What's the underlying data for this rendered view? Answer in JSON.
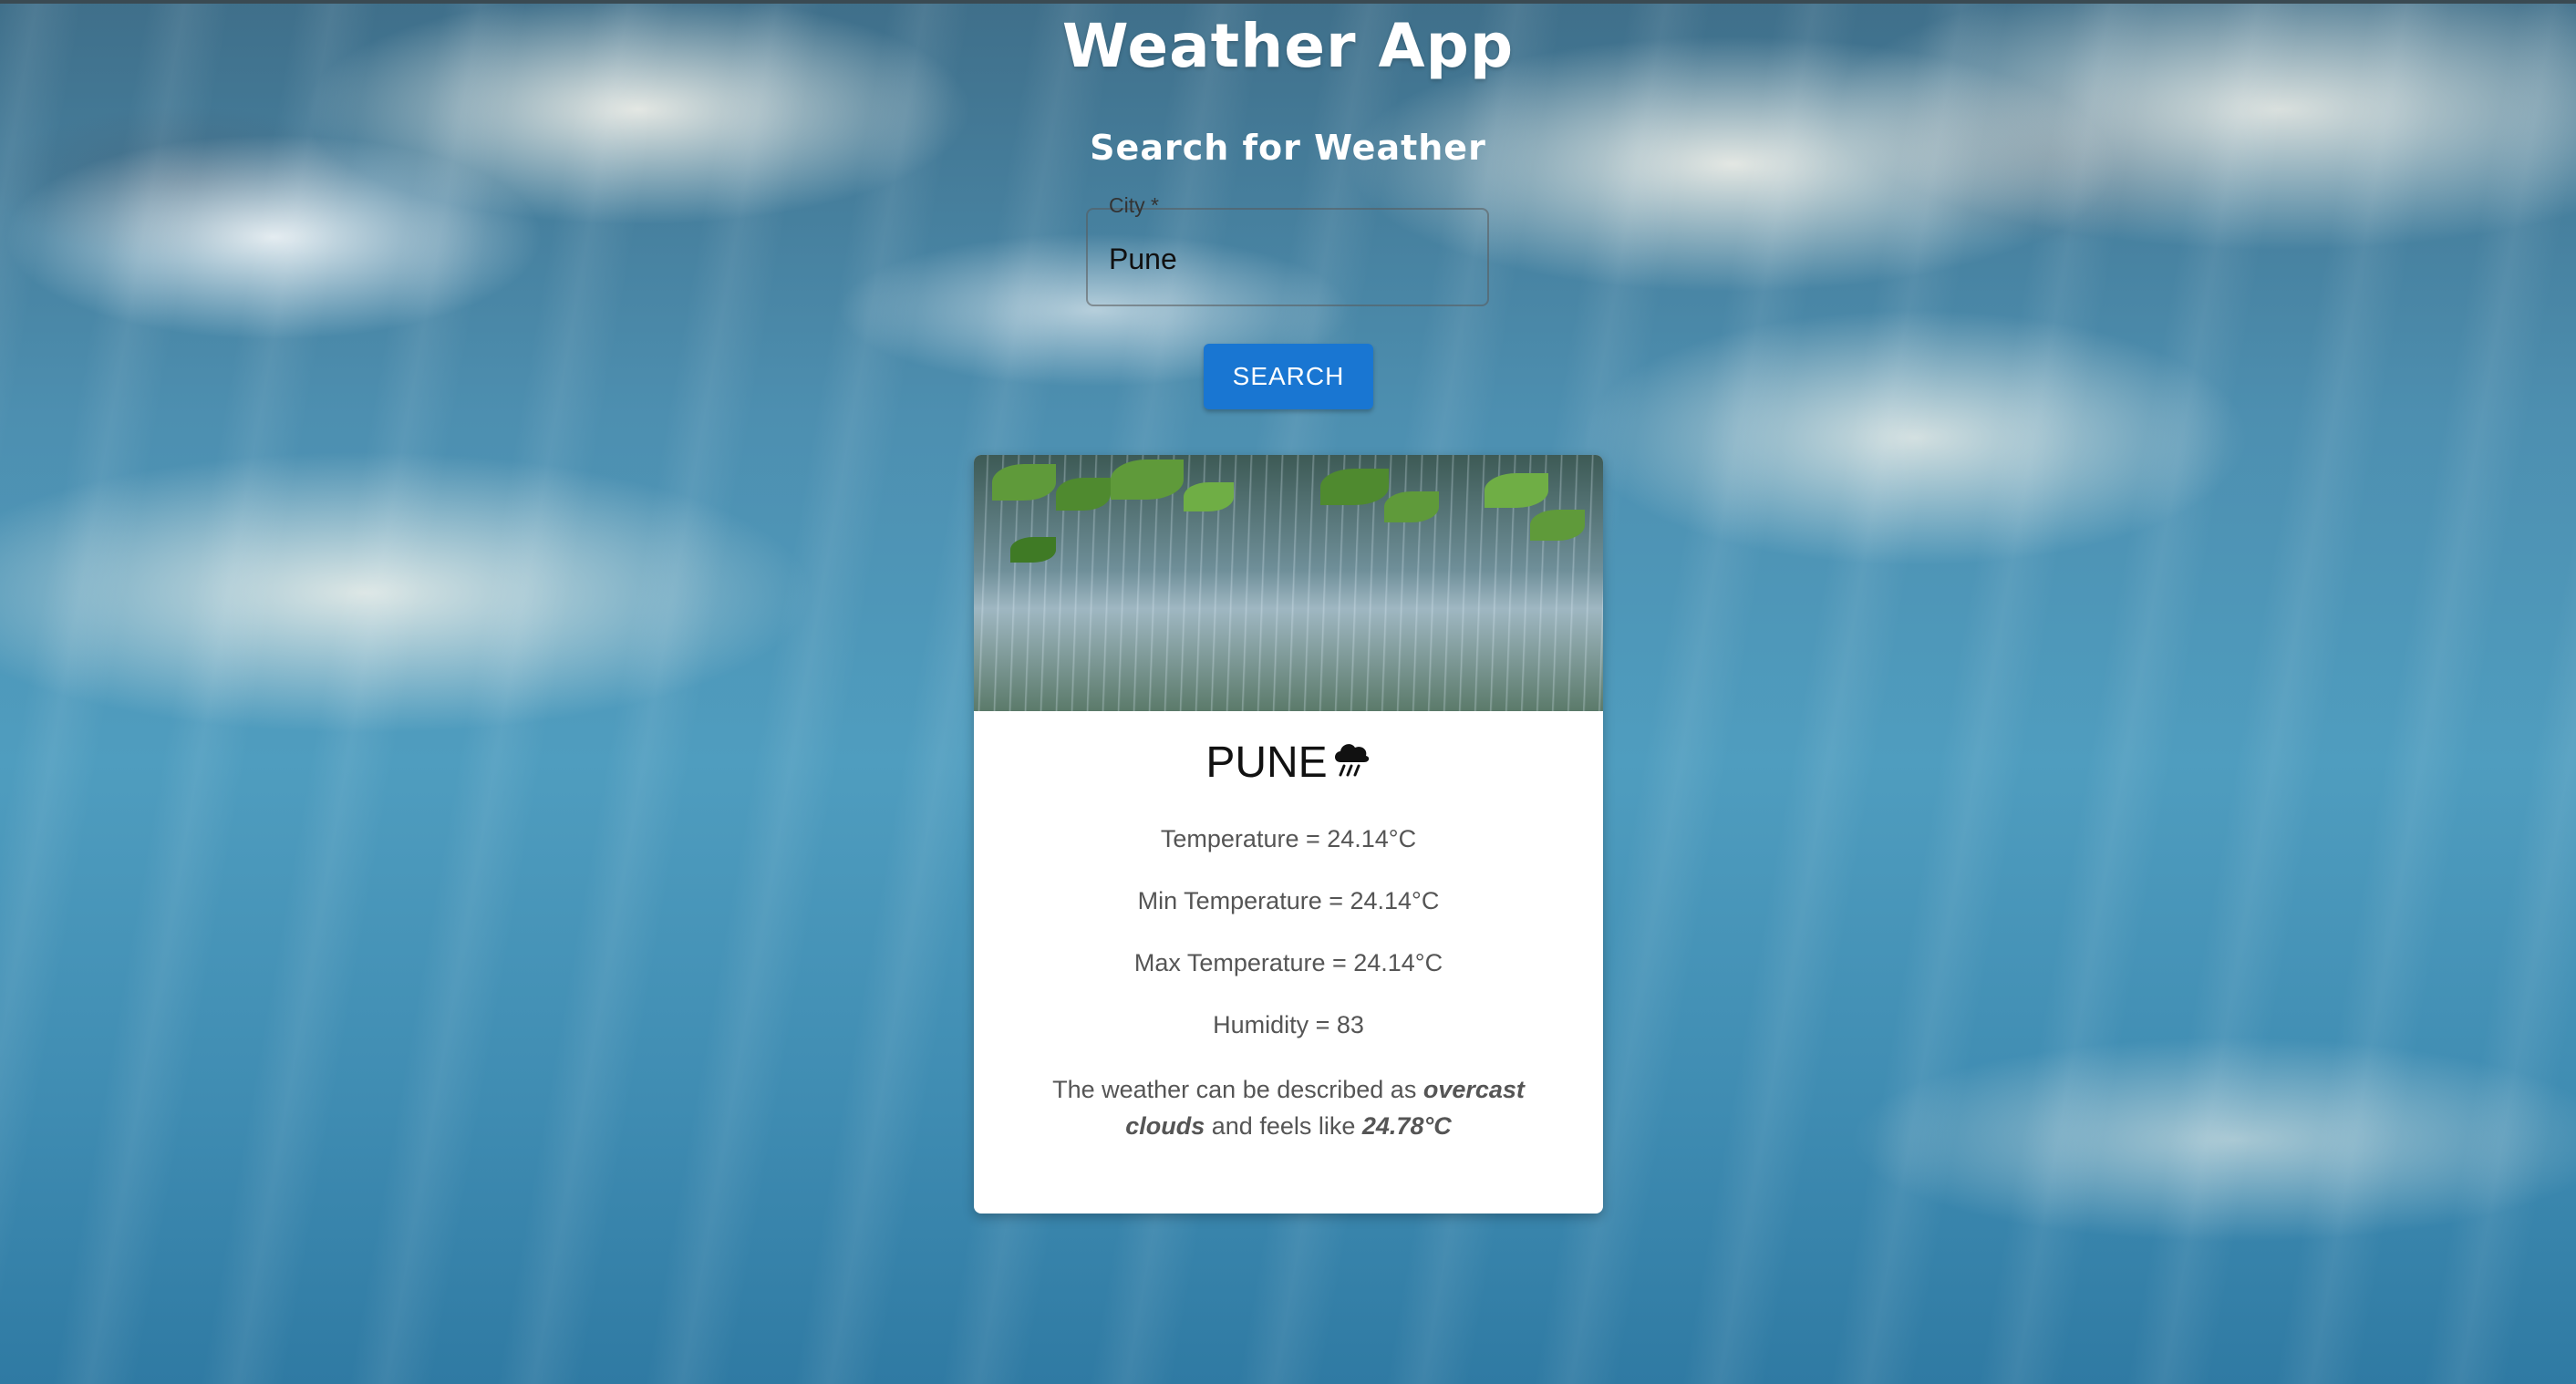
{
  "header": {
    "title": "Weather App",
    "subtitle": "Search for Weather"
  },
  "search": {
    "label": "City *",
    "value": "Pune",
    "button_label": "SEARCH"
  },
  "card": {
    "city": "PUNE",
    "icon": "cloud-rain-icon",
    "temperature": "Temperature = 24.14°C",
    "min_temperature": "Min Temperature = 24.14°C",
    "max_temperature": "Max Temperature = 24.14°C",
    "humidity": "Humidity = 83",
    "description_prefix": "The weather can be described as",
    "description": "overcast clouds",
    "feels_like_prefix": "and feels like",
    "feels_like": "24.78°C"
  },
  "colors": {
    "button": "#1976d2",
    "card_background": "#ffffff",
    "text_muted": "#555555"
  }
}
